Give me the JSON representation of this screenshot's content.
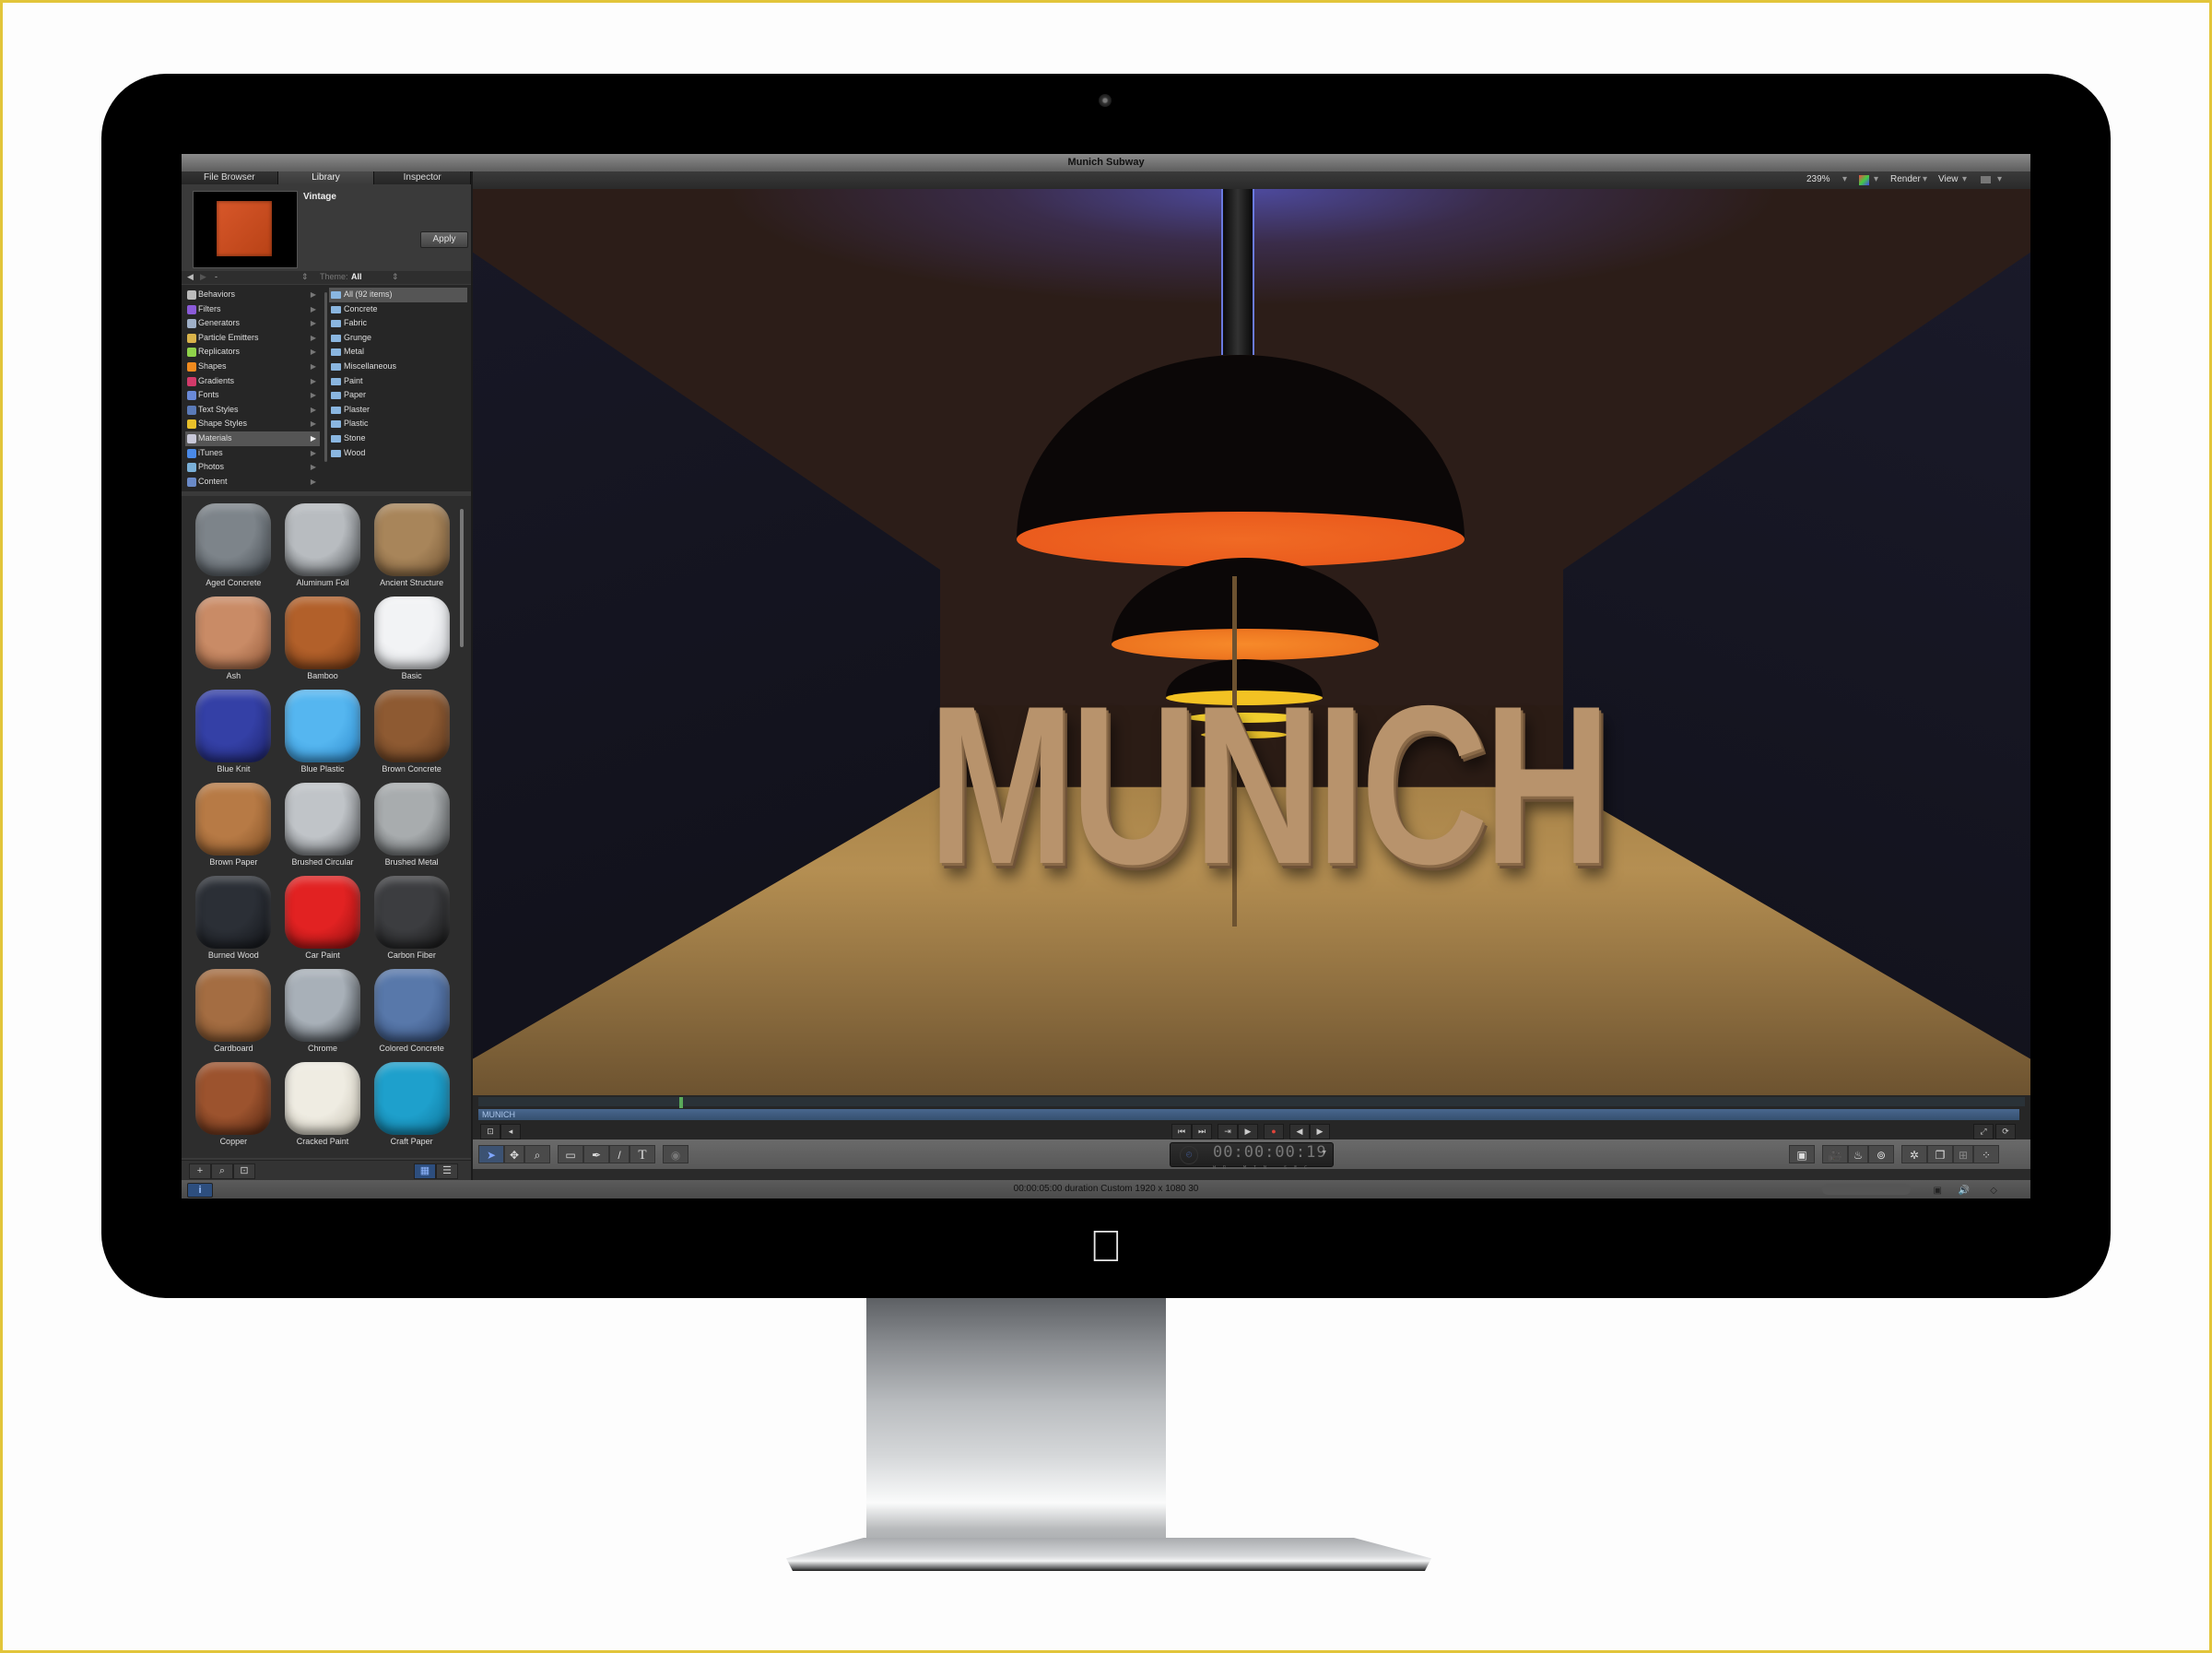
{
  "window": {
    "title": "Munich Subway"
  },
  "left_panel": {
    "tabs": [
      {
        "label": "File Browser",
        "active": false
      },
      {
        "label": "Library",
        "active": true
      },
      {
        "label": "Inspector",
        "active": false
      }
    ],
    "preview": {
      "title": "Vintage",
      "apply_label": "Apply",
      "swatch_color": "#c94d20"
    },
    "nav": {
      "back": "◀",
      "forward": "▶",
      "path": "-",
      "theme_label": "Theme:",
      "theme_value": "All"
    },
    "categories": [
      {
        "label": "Behaviors",
        "icon": "gear-icon",
        "color": "#bbbbbb"
      },
      {
        "label": "Filters",
        "icon": "filters-icon",
        "color": "#8a5ad8"
      },
      {
        "label": "Generators",
        "icon": "generators-icon",
        "color": "#9fb0c8"
      },
      {
        "label": "Particle Emitters",
        "icon": "particle-emitters-icon",
        "color": "#d9b34a"
      },
      {
        "label": "Replicators",
        "icon": "replicators-icon",
        "color": "#8fd24a"
      },
      {
        "label": "Shapes",
        "icon": "shapes-icon",
        "color": "#f08a1e"
      },
      {
        "label": "Gradients",
        "icon": "gradients-icon",
        "color": "#d23a6a"
      },
      {
        "label": "Fonts",
        "icon": "fonts-icon",
        "color": "#6a8ad8"
      },
      {
        "label": "Text Styles",
        "icon": "text-styles-icon",
        "color": "#5a7ab8"
      },
      {
        "label": "Shape Styles",
        "icon": "shape-styles-icon",
        "color": "#e8c02a"
      },
      {
        "label": "Materials",
        "icon": "materials-icon",
        "color": "#c8c8d8",
        "selected": true
      },
      {
        "label": "iTunes",
        "icon": "itunes-icon",
        "color": "#4a8ae8"
      },
      {
        "label": "Photos",
        "icon": "photos-icon",
        "color": "#7ab0d8"
      },
      {
        "label": "Content",
        "icon": "content-folder-icon",
        "color": "#6a8ac8"
      }
    ],
    "subcategories": [
      {
        "label": "All (92 items)",
        "selected": true
      },
      {
        "label": "Concrete"
      },
      {
        "label": "Fabric"
      },
      {
        "label": "Grunge"
      },
      {
        "label": "Metal"
      },
      {
        "label": "Miscellaneous"
      },
      {
        "label": "Paint"
      },
      {
        "label": "Paper"
      },
      {
        "label": "Plaster"
      },
      {
        "label": "Plastic"
      },
      {
        "label": "Stone"
      },
      {
        "label": "Wood"
      }
    ],
    "materials": [
      {
        "label": "Aged Concrete",
        "color": "#7d848a",
        "color2": "#3a4046"
      },
      {
        "label": "Aluminum Foil",
        "color": "#b8bcc0",
        "color2": "#3e4245"
      },
      {
        "label": "Ancient Structure",
        "color": "#a8855a",
        "color2": "#6d5030"
      },
      {
        "label": "Ash",
        "color": "#c98b66",
        "color2": "#8e5536"
      },
      {
        "label": "Bamboo",
        "color": "#b2602a",
        "color2": "#6e3512"
      },
      {
        "label": "Basic",
        "color": "#f2f3f5",
        "color2": "#c5c8cc"
      },
      {
        "label": "Blue Knit",
        "color": "#3440a6",
        "color2": "#1b2168"
      },
      {
        "label": "Blue Plastic",
        "color": "#55b6f0",
        "color2": "#2a86c8"
      },
      {
        "label": "Brown Concrete",
        "color": "#8e5a32",
        "color2": "#5a361c"
      },
      {
        "label": "Brown Paper",
        "color": "#b77a45",
        "color2": "#7a4b22"
      },
      {
        "label": "Brushed Circular",
        "color": "#c0c4c8",
        "color2": "#474a4d"
      },
      {
        "label": "Brushed Metal",
        "color": "#a8acae",
        "color2": "#3f4244"
      },
      {
        "label": "Burned Wood",
        "color": "#2b2f36",
        "color2": "#111317"
      },
      {
        "label": "Car Paint",
        "color": "#e22222",
        "color2": "#8a0f0f"
      },
      {
        "label": "Carbon Fiber",
        "color": "#3c3d40",
        "color2": "#111111"
      },
      {
        "label": "Cardboard",
        "color": "#a46d42",
        "color2": "#6c4322"
      },
      {
        "label": "Chrome",
        "color": "#a8b0b8",
        "color2": "#22262a"
      },
      {
        "label": "Colored Concrete",
        "color": "#5878aa",
        "color2": "#2e4670"
      },
      {
        "label": "Copper",
        "color": "#9c532e",
        "color2": "#4e220f"
      },
      {
        "label": "Cracked Paint",
        "color": "#efece2",
        "color2": "#bcb7a8"
      },
      {
        "label": "Craft Paper",
        "color": "#1ea0cc",
        "color2": "#0d6f93"
      }
    ],
    "footer": {
      "add": "+",
      "search": "⌕",
      "import": "⊡",
      "grid_view": "▦",
      "list_view": "☰"
    }
  },
  "canvas_toolbar": {
    "zoom": "239%",
    "render_label": "Render",
    "view_label": "View"
  },
  "canvas": {
    "title_text": "MUNICH"
  },
  "timeline": {
    "track_label": "MUNICH"
  },
  "transport": {
    "to_start": "⏮",
    "to_end": "⏭",
    "play_range": "⇥",
    "play": "▶",
    "record": "●",
    "prev_frame": "◀",
    "next_frame": "▶"
  },
  "toolbar": {
    "timecode": "00:00:00:19",
    "timecode_units": "HR MIN SEC FR"
  },
  "status": {
    "text": "00:00:05:00 duration Custom 1920 x 1080 30",
    "info_label": "i"
  },
  "colors": {
    "accent": "#2d4e7e",
    "track": "#48678e",
    "record": "#e0443a"
  }
}
